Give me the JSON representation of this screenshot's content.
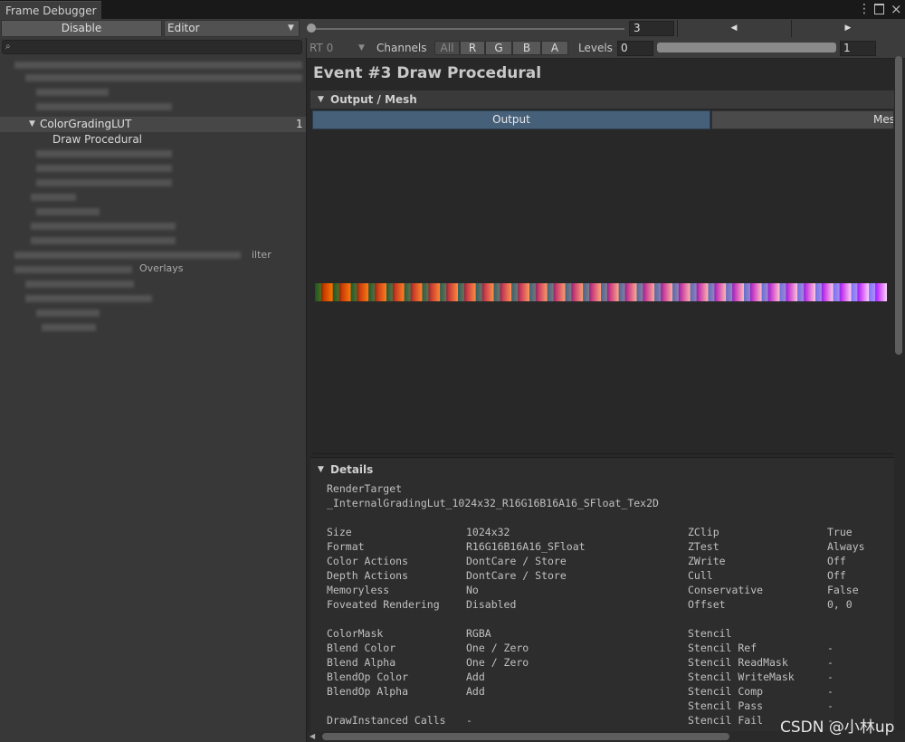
{
  "window": {
    "tab_title": "Frame Debugger",
    "menu_icon": "⋮",
    "close_icon": "×"
  },
  "toolbar": {
    "disable_label": "Disable",
    "target_selected": "Editor",
    "event_index": "3",
    "prev_icon": "◀",
    "next_icon": "▶"
  },
  "tree": {
    "selected_group": "ColorGradingLUT",
    "selected_group_count": "1",
    "selected_item": "Draw Procedural",
    "partial_labels": [
      "Overlays",
      "ilter"
    ]
  },
  "channels": {
    "rt_label": "RT 0",
    "channels_label": "Channels",
    "buttons": [
      "All",
      "R",
      "G",
      "B",
      "A"
    ],
    "levels_label": "Levels",
    "levels_min": "0",
    "levels_max": "1"
  },
  "event": {
    "title": "Event #3 Draw Procedural"
  },
  "output_section": {
    "header": "Output / Mesh",
    "tab_output": "Output",
    "tab_mesh": "Mesh"
  },
  "details": {
    "header": "Details",
    "render_target_label": "RenderTarget",
    "render_target_value": "_InternalGradingLut_1024x32_R16G16B16A16_SFloat_Tex2D",
    "left_col": [
      [
        "Size",
        "1024x32"
      ],
      [
        "Format",
        "R16G16B16A16_SFloat"
      ],
      [
        "Color Actions",
        "DontCare / Store"
      ],
      [
        "Depth Actions",
        "DontCare / Store"
      ],
      [
        "Memoryless",
        "No"
      ],
      [
        "Foveated Rendering",
        "Disabled"
      ],
      [
        "",
        ""
      ],
      [
        "ColorMask",
        "RGBA"
      ],
      [
        "Blend Color",
        "One / Zero"
      ],
      [
        "Blend Alpha",
        "One / Zero"
      ],
      [
        "BlendOp Color",
        "Add"
      ],
      [
        "BlendOp Alpha",
        "Add"
      ],
      [
        "",
        ""
      ],
      [
        "DrawInstanced Calls",
        "-"
      ]
    ],
    "right_col": [
      [
        "ZClip",
        "True"
      ],
      [
        "ZTest",
        "Always"
      ],
      [
        "ZWrite",
        "Off"
      ],
      [
        "Cull",
        "Off"
      ],
      [
        "Conservative",
        "False"
      ],
      [
        "Offset",
        "0, 0"
      ],
      [
        "",
        ""
      ],
      [
        "Stencil",
        ""
      ],
      [
        "Stencil Ref",
        "-"
      ],
      [
        "Stencil ReadMask",
        "-"
      ],
      [
        "Stencil WriteMask",
        "-"
      ],
      [
        "Stencil Comp",
        "-"
      ],
      [
        "Stencil Pass",
        "-"
      ],
      [
        "Stencil Fail",
        "-"
      ]
    ]
  },
  "watermark": "CSDN @小林up",
  "colors": {
    "accent_tab": "#46607a",
    "panel": "#383838",
    "background": "#282828"
  }
}
